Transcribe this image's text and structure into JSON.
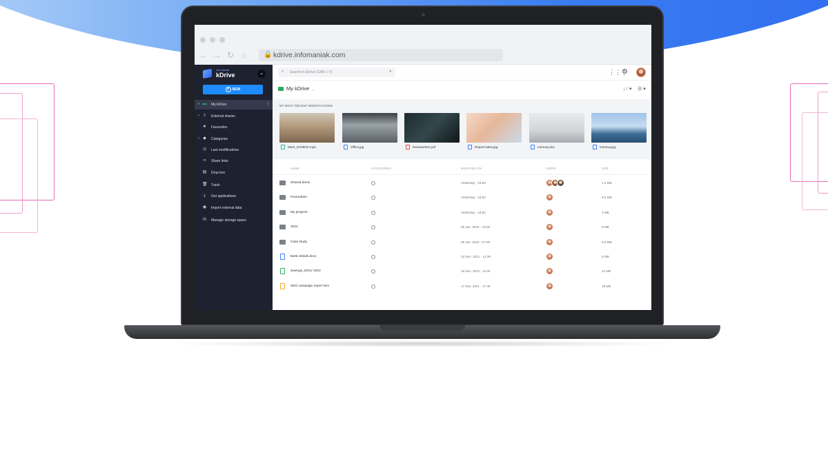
{
  "browser": {
    "url": "kdrive.infomaniak.com"
  },
  "brand": {
    "company": "infomaniak",
    "product": "kDrive"
  },
  "sidebar": {
    "new_label": "NEW",
    "items": [
      {
        "label": "My kDrive",
        "icon": "drive-icon",
        "chevron": true,
        "active": true
      },
      {
        "label": "External shares",
        "icon": "share-icon",
        "chevron": true,
        "active": false
      },
      {
        "label": "Favourites",
        "icon": "star-icon",
        "chevron": false,
        "active": false
      },
      {
        "label": "Categories",
        "icon": "tag-icon",
        "chevron": true,
        "active": false
      },
      {
        "label": "Last modifications",
        "icon": "clock-icon",
        "chevron": false,
        "active": false
      },
      {
        "label": "Share links",
        "icon": "link-icon",
        "chevron": false,
        "active": false
      },
      {
        "label": "Drop box",
        "icon": "dropbox-icon",
        "chevron": false,
        "active": false
      },
      {
        "label": "Trash",
        "icon": "trash-icon",
        "chevron": false,
        "active": false
      },
      {
        "label": "Get applications",
        "icon": "download-icon",
        "chevron": false,
        "active": false
      },
      {
        "label": "Import external data",
        "icon": "import-icon",
        "chevron": false,
        "active": false
      },
      {
        "label": "Manage storage space",
        "icon": "storage-icon",
        "chevron": false,
        "active": false
      }
    ]
  },
  "topbar": {
    "search_placeholder": "Search in kDrive (CMD + F)"
  },
  "breadcrumb": {
    "title": "My kDrive"
  },
  "recent": {
    "title": "MY MOST RECENT MODIFICATIONS",
    "files": [
      {
        "name": "Meet_21/09/22.mp4",
        "type": "video",
        "type_color": "#27b1a6",
        "thumb": "meeting"
      },
      {
        "name": "Office.jpg",
        "type": "image",
        "type_color": "#3d7ff5",
        "thumb": "office"
      },
      {
        "name": "Review2022.pdf",
        "type": "pdf",
        "type_color": "#e5483b",
        "thumb": "review"
      },
      {
        "name": "Report-sales.jpg",
        "type": "image",
        "type_color": "#3d7ff5",
        "thumb": "report"
      },
      {
        "name": "memory.doc",
        "type": "doc",
        "type_color": "#3d7ff5",
        "thumb": "memory"
      },
      {
        "name": "Geneva.jpg",
        "type": "image",
        "type_color": "#3d7ff5",
        "thumb": "geneva"
      }
    ]
  },
  "table": {
    "headers": {
      "name": "NAME",
      "categories": "CATEGORIES",
      "modified": "MODIFIED ON",
      "users": "USERS",
      "size": "SIZE"
    },
    "rows": [
      {
        "name": "Shared items",
        "kind": "folder",
        "modified": "Yesterday - 16:50",
        "users": 3,
        "size": "1,2 MB"
      },
      {
        "name": "Facturation",
        "kind": "folder",
        "modified": "Yesterday - 16:50",
        "users": 1,
        "size": "9.8 MB"
      },
      {
        "name": "My projects",
        "kind": "folder",
        "modified": "Yesterday - 16:50",
        "users": 1,
        "size": "2 MB"
      },
      {
        "name": "2022",
        "kind": "folder",
        "modified": "08 Jan. 2022 - 15:00",
        "users": 1,
        "size": "9 MB"
      },
      {
        "name": "Case study",
        "kind": "folder",
        "modified": "06 Jan. 2022 - 07:00",
        "users": 1,
        "size": "9.8 MB"
      },
      {
        "name": "Bank details.docx",
        "kind": "doc",
        "modified": "22 Dec. 2021 - 14:38",
        "users": 1,
        "size": "5 MB"
      },
      {
        "name": "Savings_2021/ 2022",
        "kind": "sheet",
        "modified": "15 Dec. 2021 - 11:00",
        "users": 1,
        "size": "12 MB"
      },
      {
        "name": "SEO campaign report Nov",
        "kind": "pres",
        "modified": "17 Nov. 2021 - 17:40",
        "users": 1,
        "size": "18 MB"
      }
    ]
  },
  "colors": {
    "accent": "#1e8cff",
    "sidebar_bg": "#1d2130",
    "hero_blue": "#2f6bf0",
    "deco_pink": "#e46bb0"
  }
}
